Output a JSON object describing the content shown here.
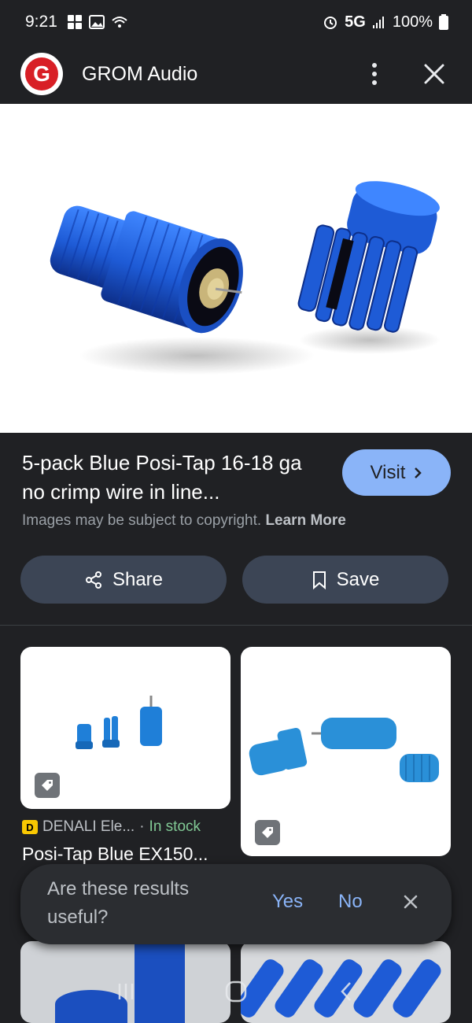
{
  "status_bar": {
    "time": "9:21",
    "network": "5G",
    "battery": "100%",
    "icons": [
      "grid-icon",
      "image-icon",
      "wifi-call-icon",
      "alarm-icon",
      "signal-icon",
      "battery-icon"
    ]
  },
  "header": {
    "logo_letter": "G",
    "title": "GROM Audio",
    "brand_color": "#d81f26"
  },
  "result": {
    "title": "5-pack Blue Posi-Tap 16-18 ga no crimp wire in line...",
    "visit_label": "Visit",
    "copyright_text": "Images may be subject to copyright.",
    "learn_more": "Learn More",
    "share_label": "Share",
    "save_label": "Save"
  },
  "related": {
    "card1": {
      "source": "DENALI Ele...",
      "separator": "·",
      "stock": "In stock",
      "title": "Posi-Tap Blue EX150..."
    }
  },
  "feedback": {
    "question": "Are these results useful?",
    "yes": "Yes",
    "no": "No"
  },
  "colors": {
    "background": "#202124",
    "accent": "#8ab4f8",
    "product_blue": "#1e5bd6",
    "stock_green": "#81c995"
  }
}
